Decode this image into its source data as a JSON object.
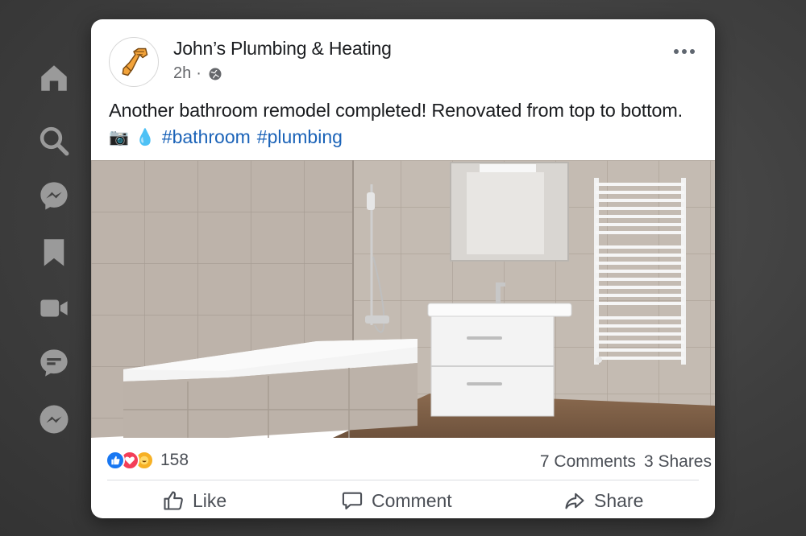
{
  "rail": {
    "items": [
      {
        "icon": "home-icon"
      },
      {
        "icon": "search-icon"
      },
      {
        "icon": "messenger-icon"
      },
      {
        "icon": "bookmark-icon"
      },
      {
        "icon": "video-icon"
      },
      {
        "icon": "chat-bubble-icon"
      },
      {
        "icon": "messenger-icon"
      }
    ]
  },
  "post": {
    "author": "John’s Plumbing & Heating",
    "time": "2h",
    "separator": "·",
    "text": "Another bathroom remodel completed! Renovated from top to bottom.",
    "emoji_camera": "📷",
    "emoji_droplet": "💧",
    "hashtags": [
      "#bathroom",
      "#plumbing"
    ]
  },
  "stats": {
    "reaction_count": "158",
    "comments": "7 Comments",
    "shares": "3 Shares"
  },
  "actions": {
    "like": "Like",
    "comment": "Comment",
    "share": "Share"
  },
  "colors": {
    "link": "#1b63b8",
    "like_blue": "#1877f2",
    "love_red": "#f33e58",
    "haha_yellow": "#f7b125",
    "rail_icon": "#9a9a9a"
  }
}
